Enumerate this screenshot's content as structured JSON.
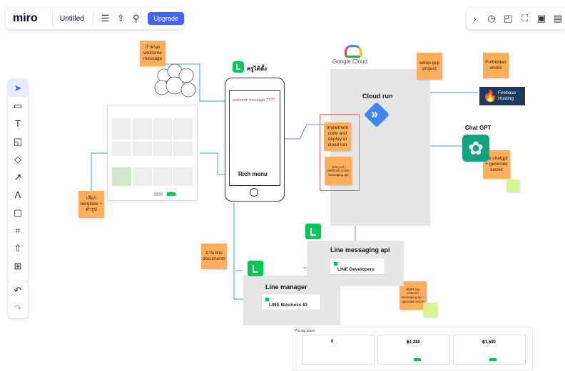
{
  "header": {
    "logo": "miro",
    "board_title": "Untitled",
    "upgrade_label": "Upgrade",
    "icons": [
      "menu-icon",
      "share-icon",
      "search-icon"
    ]
  },
  "top_right_icons": [
    "chevron-right-icon",
    "timer-icon",
    "comment-icon",
    "focus-icon",
    "page-icon",
    "menu-more-icon"
  ],
  "toolbar": {
    "tools": [
      "select-icon",
      "frame-icon",
      "text-icon",
      "sticky-note-icon",
      "shapes-icon",
      "arrow-icon",
      "pen-icon",
      "comment-icon",
      "crop-icon",
      "upload-icon",
      "add-icon"
    ],
    "history": [
      "undo-icon",
      "redo-icon"
    ]
  },
  "board": {
    "stickies": {
      "welcome": "กำหนด welcome message",
      "template": "เลือก template + ทำรูป",
      "setup_gcp": "setup gcp project",
      "implement": "implement code and deploy at cloud run",
      "bring_webhook": "bring url webhook to line messaging api",
      "forbidden": "Forbidden words",
      "chatgpt_note": "ขอ chatgpt + generate secret",
      "line_doc": "อ่าน line documents",
      "channel": "สมัคร line channel messaging api + generate secret"
    },
    "phone": {
      "brand": "ครูได้ตั้ง",
      "welcome_text": "welcome message ????",
      "rich_menu": "Rich menu"
    },
    "labels": {
      "google_cloud": "Google Cloud",
      "cloud_run": "Cloud run",
      "chat_gpt": "Chat GPT",
      "firebase": "Firebase Hosting",
      "line_messaging": "Line messaging api",
      "line_developers": "LINE Developers",
      "line_manager": "Line manager",
      "line_business": "LINE Business ID"
    },
    "pricing": {
      "title": "Pricing plans",
      "prices": [
        "0",
        "฿1,280",
        "฿1,500"
      ]
    }
  }
}
